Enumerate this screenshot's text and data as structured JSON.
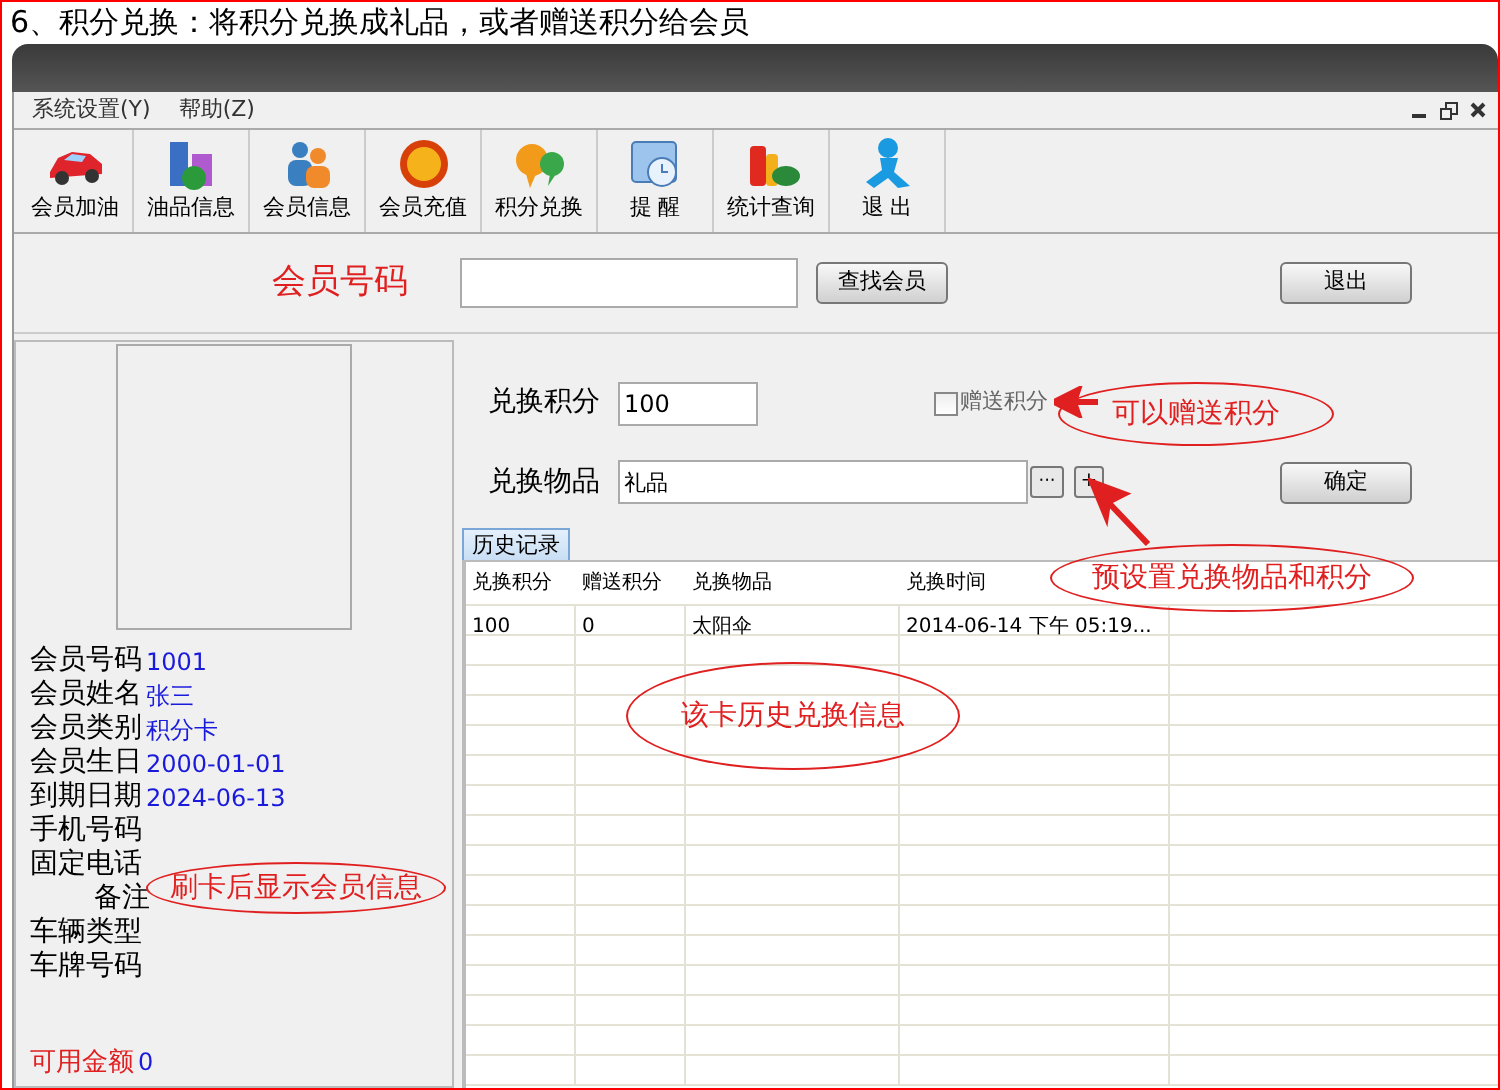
{
  "caption": "6、积分兑换：将积分兑换成礼品，或者赠送积分给会员",
  "menu": [
    {
      "label": "系统设置(Y)"
    },
    {
      "label": "帮助(Z)"
    }
  ],
  "toolbar": [
    {
      "label": "会员加油",
      "kind": "car"
    },
    {
      "label": "油品信息",
      "kind": "beaker"
    },
    {
      "label": "会员信息",
      "kind": "people"
    },
    {
      "label": "会员充值",
      "kind": "coin"
    },
    {
      "label": "积分兑换",
      "kind": "bubbles"
    },
    {
      "label": "提 醒",
      "kind": "clock"
    },
    {
      "label": "统计查询",
      "kind": "bottles"
    },
    {
      "label": "退 出",
      "kind": "runner"
    }
  ],
  "search": {
    "label": "会员号码",
    "find_button": "查找会员",
    "exit_button": "退出"
  },
  "member": {
    "fields": [
      {
        "label": "会员号码",
        "value": "1001",
        "kind": "plain"
      },
      {
        "label": "会员姓名",
        "value": "张三",
        "kind": "plain"
      },
      {
        "label": "会员类别",
        "value": "积分卡",
        "kind": "plain"
      },
      {
        "label": "会员生日",
        "value": "2000-01-01",
        "kind": "plain"
      },
      {
        "label": "到期日期",
        "value": "2024-06-13",
        "kind": "plain"
      },
      {
        "label": "手机号码",
        "kind": "plain"
      },
      {
        "label": "固定电话",
        "kind": "plain"
      },
      {
        "label": "备注",
        "kind": "note"
      },
      {
        "label": "车辆类型",
        "kind": "plain"
      },
      {
        "label": "车牌号码",
        "kind": "plain"
      }
    ],
    "balance": {
      "label": "可用金额",
      "value": "0"
    }
  },
  "exchange": {
    "points_label": "兑换积分",
    "points_value": "100",
    "gift": {
      "label": "赠送积分",
      "checked": false
    },
    "item_label": "兑换物品",
    "item_value": "礼品",
    "browse_button": "···",
    "add_button": "+",
    "confirm_button": "确定"
  },
  "tabs": [
    {
      "label": "历史记录",
      "selected": true
    }
  ],
  "table": {
    "columns": [
      "兑换积分",
      "赠送积分",
      "兑换物品",
      "兑换时间"
    ],
    "rows": [
      [
        "100",
        "0",
        "太阳伞",
        "2014-06-14 下午 05:19..."
      ]
    ]
  },
  "annotations": [
    {
      "text": "可以赠送积分"
    },
    {
      "text": "预设置兑换物品和积分"
    },
    {
      "text": "该卡历史兑换信息"
    },
    {
      "text": "刷卡后显示会员信息"
    }
  ]
}
